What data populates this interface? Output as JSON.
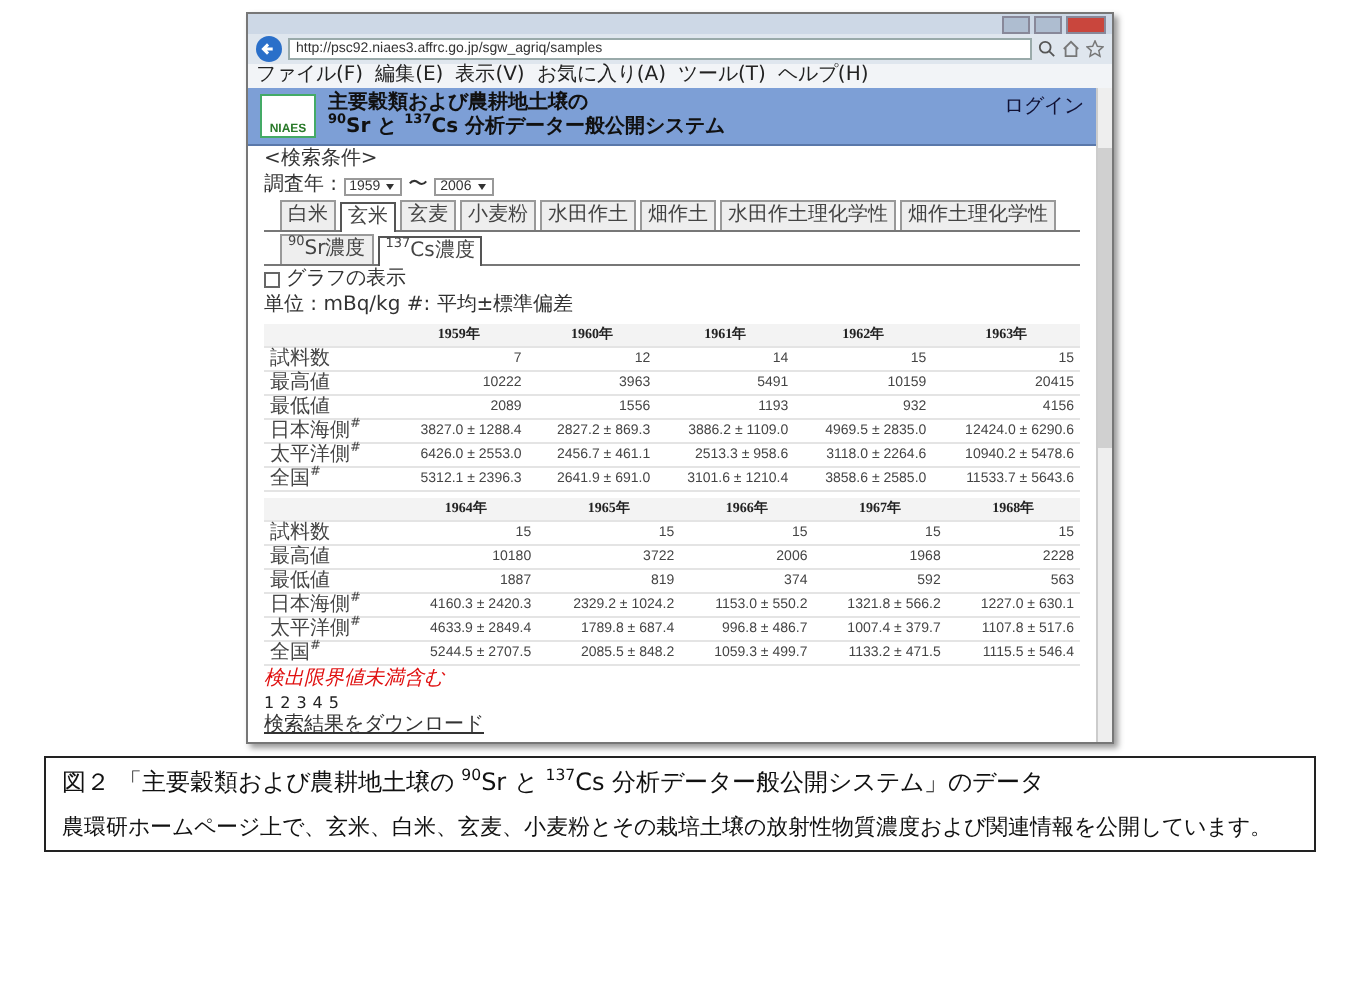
{
  "browser": {
    "address": "http://psc92.niaes3.affrc.go.jp/sgw_agriq/samples",
    "menu": [
      "ファイル(F)",
      "編集(E)",
      "表示(V)",
      "お気に入り(A)",
      "ツール(T)",
      "ヘルプ(H)"
    ]
  },
  "site": {
    "logo": "NIAES",
    "title_lines": [
      "主要穀類および農耕地土壌の",
      "$^{90}$Sr と $^{137}$Cs 分析データー般公開システム"
    ],
    "login": "ログイン"
  },
  "search_condition": "<検索条件>",
  "year_range": {
    "label": "調査年 :",
    "from": "1959",
    "separator": "〜",
    "to": "2006"
  },
  "tabs": [
    {
      "label": "白米",
      "selected": false
    },
    {
      "label": "玄米",
      "selected": true
    },
    {
      "label": "玄麦",
      "selected": false
    },
    {
      "label": "小麦粉",
      "selected": false
    },
    {
      "label": "水田作土",
      "selected": false
    },
    {
      "label": "畑作土",
      "selected": false
    },
    {
      "label": "水田作土理化学性",
      "selected": false
    },
    {
      "label": "畑作土理化学性",
      "selected": false
    }
  ],
  "subtabs": [
    {
      "label": "$^{90}$Sr濃度",
      "selected": false
    },
    {
      "label": "$^{137}$Cs濃度",
      "selected": true
    }
  ],
  "graph_checkbox": {
    "label": "グラフの表示",
    "checked": false
  },
  "unit_note": "単位 : mBq/kg #: 平均±標準偏差",
  "tables": [
    {
      "years": [
        "1959年",
        "1960年",
        "1961年",
        "1962年",
        "1963年"
      ],
      "rows": [
        {
          "label": "試料数",
          "values": [
            "7",
            "12",
            "14",
            "15",
            "15"
          ]
        },
        {
          "label": "最高値",
          "values": [
            "10222",
            "3963",
            "5491",
            "10159",
            "20415"
          ]
        },
        {
          "label": "最低値",
          "values": [
            "2089",
            "1556",
            "1193",
            "932",
            "4156"
          ]
        },
        {
          "label": "日本海側$^{#}$",
          "values": [
            "3827.0 ± 1288.4",
            "2827.2 ± 869.3",
            "3886.2 ± 1109.0",
            "4969.5 ± 2835.0",
            "12424.0 ± 6290.6"
          ]
        },
        {
          "label": "太平洋側$^{#}$",
          "values": [
            "6426.0 ± 2553.0",
            "2456.7 ± 461.1",
            "2513.3 ± 958.6",
            "3118.0 ± 2264.6",
            "10940.2 ± 5478.6"
          ]
        },
        {
          "label": "全国$^{#}$",
          "values": [
            "5312.1 ± 2396.3",
            "2641.9 ± 691.0",
            "3101.6 ± 1210.4",
            "3858.6 ± 2585.0",
            "11533.7 ± 5643.6"
          ]
        }
      ]
    },
    {
      "years": [
        "1964年",
        "1965年",
        "1966年",
        "1967年",
        "1968年"
      ],
      "rows": [
        {
          "label": "試料数",
          "values": [
            "15",
            "15",
            "15",
            "15",
            "15"
          ]
        },
        {
          "label": "最高値",
          "values": [
            "10180",
            "3722",
            "2006",
            "1968",
            "2228"
          ]
        },
        {
          "label": "最低値",
          "values": [
            "1887",
            "819",
            "374",
            "592",
            "563"
          ]
        },
        {
          "label": "日本海側$^{#}$",
          "values": [
            "4160.3 ± 2420.3",
            "2329.2 ± 1024.2",
            "1153.0 ± 550.2",
            "1321.8 ± 566.2",
            "1227.0 ± 630.1"
          ]
        },
        {
          "label": "太平洋側$^{#}$",
          "values": [
            "4633.9 ± 2849.4",
            "1789.8 ± 687.4",
            "996.8 ± 486.7",
            "1007.4 ± 379.7",
            "1107.8 ± 517.6"
          ]
        },
        {
          "label": "全国$^{#}$",
          "values": [
            "5244.5 ± 2707.5",
            "2085.5 ± 848.2",
            "1059.3 ± 499.7",
            "1133.2 ± 471.5",
            "1115.5 ± 546.4"
          ]
        }
      ]
    }
  ],
  "red_note": "検出限界値未満含む",
  "pages": [
    "1",
    "2",
    "3",
    "4",
    "5"
  ],
  "download_link": "検索結果をダウンロード",
  "caption": {
    "title": "図２ 「主要穀類および農耕地土壌の $^{90}$Sr と $^{137}$Cs 分析データー般公開システム」のデータ",
    "body": "農環研ホームページ上で、玄米、白米、玄麦、小麦粉とその栽培土壌の放射性物質濃度および関連情報を公開しています。"
  }
}
